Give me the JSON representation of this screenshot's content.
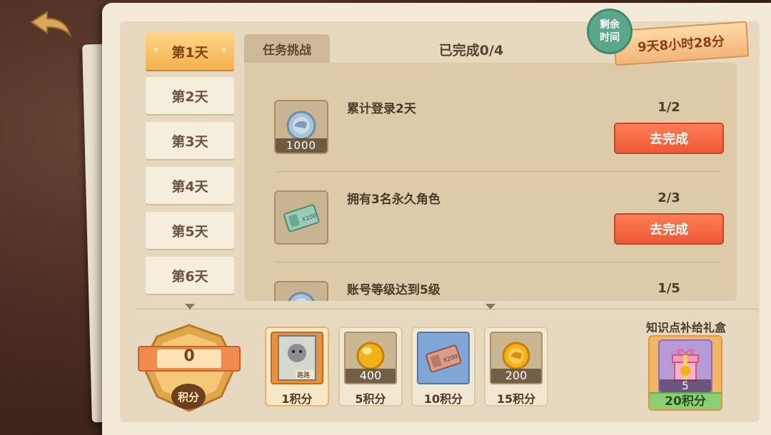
{
  "colors": {
    "accent_orange": "#ec5a38",
    "active_tab": "#f6b04e",
    "timer_badge": "#5aa78a",
    "gift_cost_bg": "#8ccf72"
  },
  "nav": {
    "back_icon": "back-arrow-icon"
  },
  "days": [
    {
      "label": "第1天",
      "active": true
    },
    {
      "label": "第2天",
      "active": false
    },
    {
      "label": "第3天",
      "active": false
    },
    {
      "label": "第4天",
      "active": false
    },
    {
      "label": "第5天",
      "active": false
    },
    {
      "label": "第6天",
      "active": false
    }
  ],
  "header": {
    "task_tab_label": "任务挑战",
    "progress": "已完成0/4"
  },
  "timer": {
    "badge_line1": "剩余",
    "badge_line2": "时间",
    "remaining": "9天8小时28分"
  },
  "tasks": [
    {
      "name": "累计登录2天",
      "count": "1/2",
      "reward_qty": "1000",
      "icon": "silver-coin-icon",
      "button": "去完成"
    },
    {
      "name": "拥有3名永久角色",
      "count": "2/3",
      "reward_qty": "",
      "icon": "ticket-x100-icon",
      "button": "去完成"
    },
    {
      "name": "账号等级达到5级",
      "count": "1/5",
      "reward_qty": "",
      "icon": "silver-coin-icon",
      "button": ""
    }
  ],
  "score": {
    "value": "0",
    "label": "积分"
  },
  "rewards": [
    {
      "qty": "",
      "cost": "1积分",
      "icon": "character-card-icon",
      "card_label": "路路",
      "highlight": true
    },
    {
      "qty": "400",
      "cost": "5积分",
      "icon": "gold-orb-icon",
      "highlight": false
    },
    {
      "qty": "",
      "cost": "10积分",
      "icon": "ticket-x200-icon",
      "highlight": false
    },
    {
      "qty": "200",
      "cost": "15积分",
      "icon": "gold-coin-icon",
      "highlight": false
    }
  ],
  "gift": {
    "title": "知识点补给礼盒",
    "qty": "5",
    "cost": "20积分",
    "icon": "gift-box-icon"
  }
}
